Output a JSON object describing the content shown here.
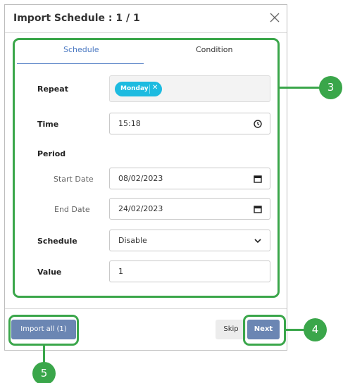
{
  "dialog": {
    "title": "Import Schedule : 1 / 1"
  },
  "tabs": [
    {
      "label": "Schedule",
      "active": true
    },
    {
      "label": "Condition",
      "active": false
    }
  ],
  "form": {
    "repeat_label": "Repeat",
    "repeat_chip": "Monday",
    "time_label": "Time",
    "time_value": "15:18",
    "period_label": "Period",
    "start_label": "Start Date",
    "start_value": "08/02/2023",
    "end_label": "End Date",
    "end_value": "24/02/2023",
    "schedule_label": "Schedule",
    "schedule_value": "Disable",
    "value_label": "Value",
    "value_value": "1"
  },
  "footer": {
    "import_all": "Import all (1)",
    "skip": "Skip",
    "next": "Next"
  },
  "callouts": [
    "3",
    "4",
    "5"
  ],
  "colors": {
    "accent": "#3aa64a",
    "tab_active": "#4a78c2",
    "chip": "#1dbbe0",
    "primary_button": "#6b86b3"
  },
  "icons": [
    "close-icon",
    "clock-icon",
    "calendar-icon",
    "chevron-down-icon",
    "chip-remove-icon"
  ]
}
